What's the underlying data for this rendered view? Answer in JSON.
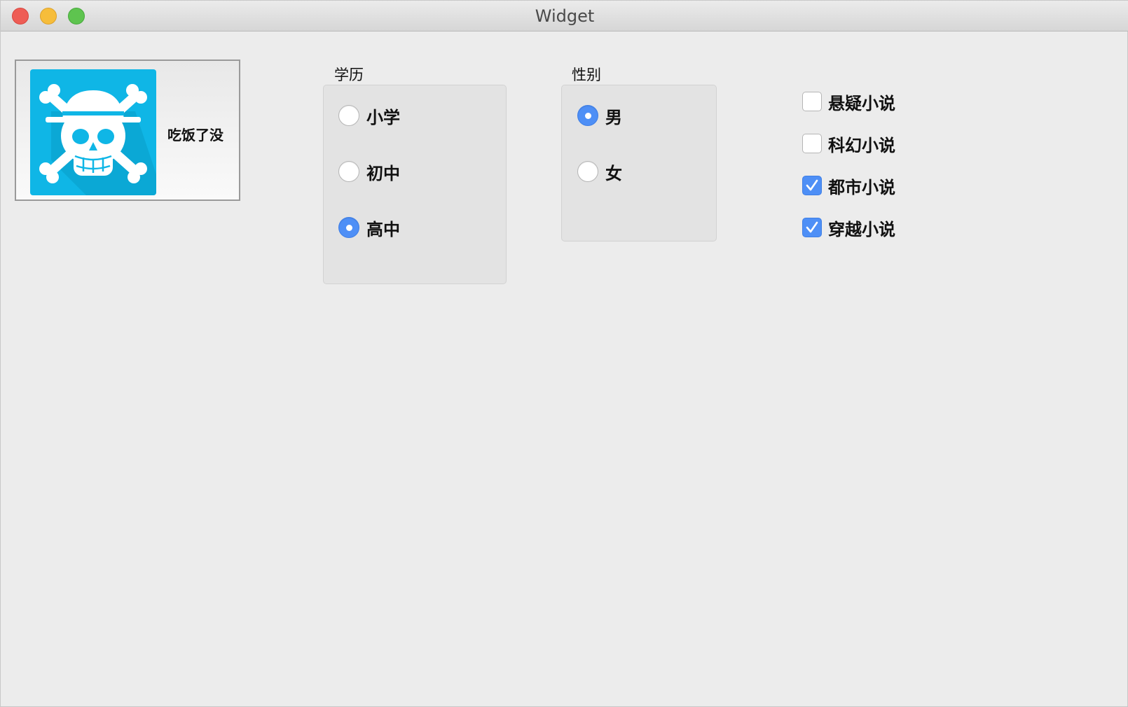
{
  "window": {
    "title": "Widget"
  },
  "tool_button": {
    "label": "吃饭了没",
    "icon": "straw-hat-skull-icon",
    "icon_color": "#0fb6e6"
  },
  "education_group": {
    "title": "学历",
    "options": [
      {
        "label": "小学",
        "checked": false
      },
      {
        "label": "初中",
        "checked": false
      },
      {
        "label": "高中",
        "checked": true
      }
    ]
  },
  "gender_group": {
    "title": "性别",
    "options": [
      {
        "label": "男",
        "checked": true
      },
      {
        "label": "女",
        "checked": false
      }
    ]
  },
  "novel_checkboxes": [
    {
      "label": "悬疑小说",
      "checked": false
    },
    {
      "label": "科幻小说",
      "checked": false
    },
    {
      "label": "都市小说",
      "checked": true
    },
    {
      "label": "穿越小说",
      "checked": true
    }
  ],
  "colors": {
    "accent": "#4e8ff6",
    "window_bg": "#ececec"
  }
}
